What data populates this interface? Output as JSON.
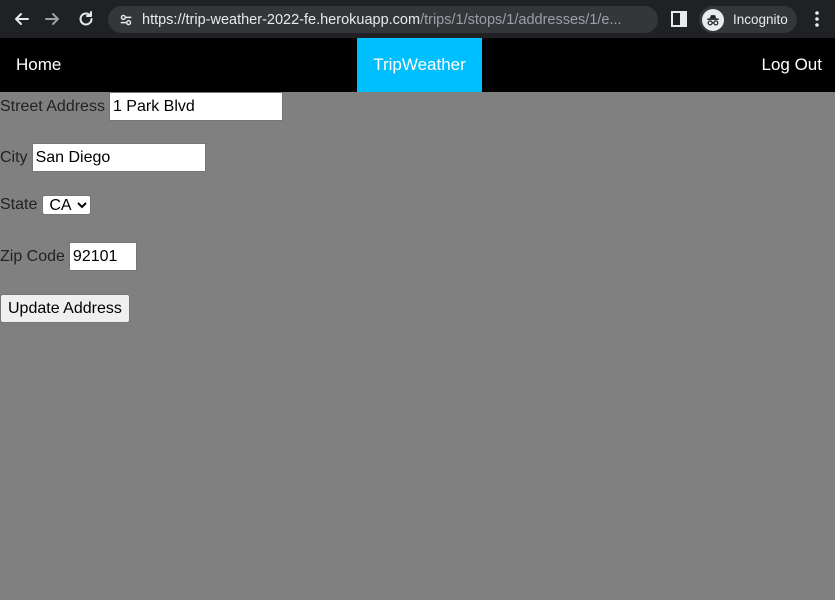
{
  "browser": {
    "url_host": "https://trip-weather-2022-fe.herokuapp.com",
    "url_path": "/trips/1/stops/1/addresses/1/e...",
    "profile_label": "Incognito"
  },
  "nav": {
    "home": "Home",
    "brand": "TripWeather",
    "logout": "Log Out",
    "brand_color": "#00bfff"
  },
  "form": {
    "street_label": "Street Address",
    "street_value": "1 Park Blvd",
    "city_label": "City",
    "city_value": "San Diego",
    "state_label": "State",
    "state_value": "CA",
    "zip_label": "Zip Code",
    "zip_value": "92101",
    "submit_label": "Update Address"
  },
  "colors": {
    "page_background": "#808080",
    "nav_background": "#000000"
  }
}
